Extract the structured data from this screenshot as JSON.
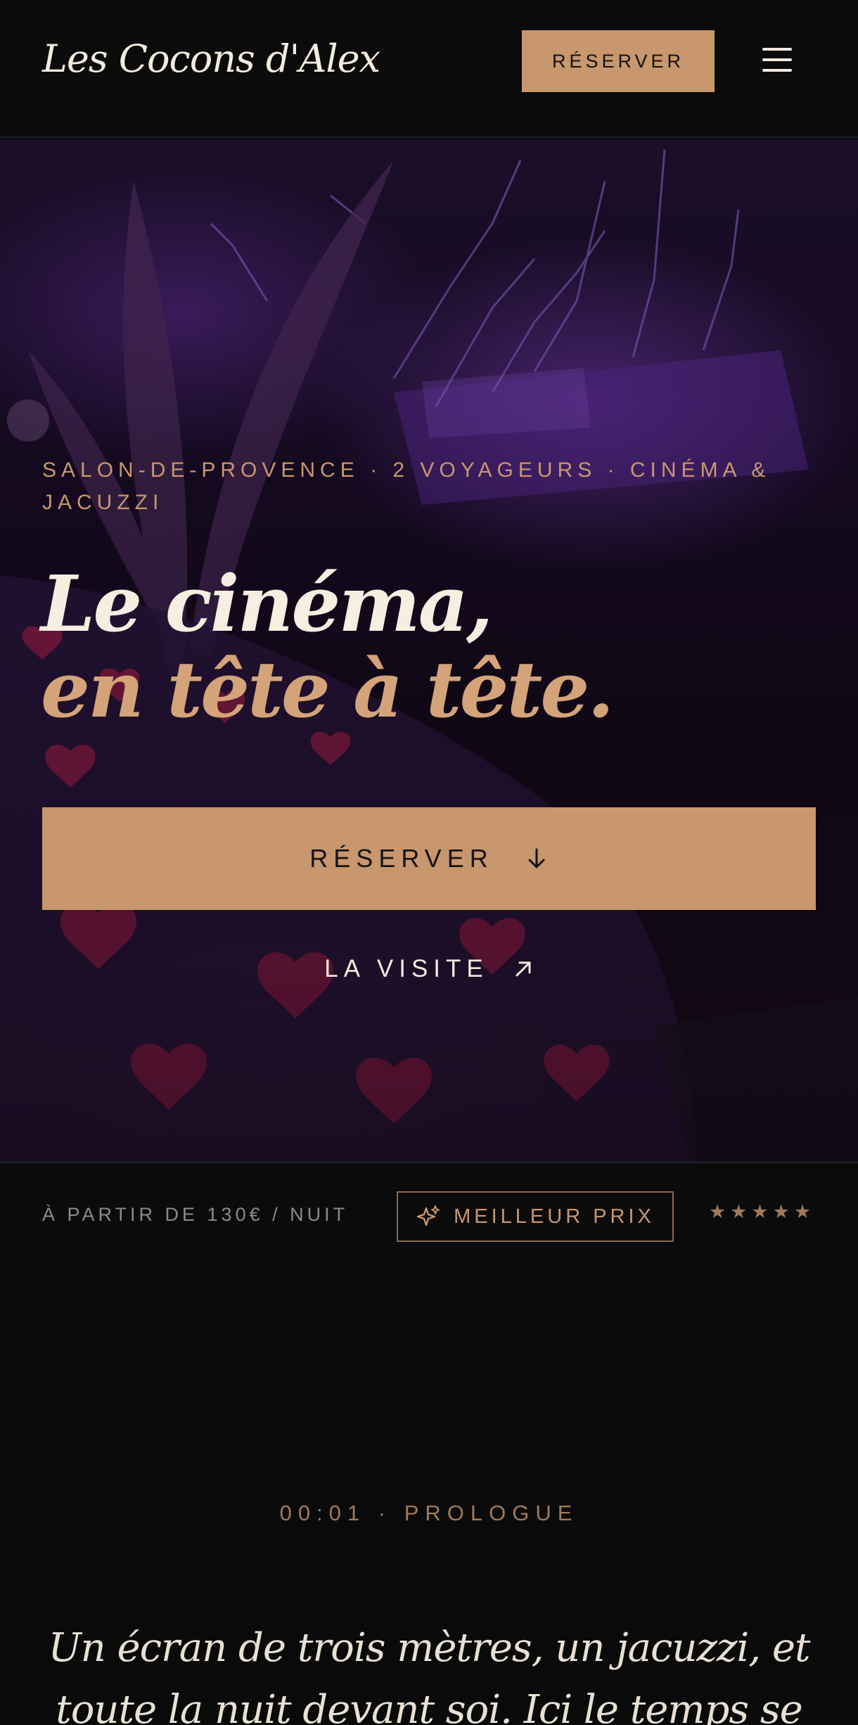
{
  "header": {
    "brand": "Les Cocons d'Alex",
    "reserve_label": "RÉSERVER",
    "menu_icon": "hamburger-menu-icon"
  },
  "hero": {
    "eyebrow": "SALON-DE-PROVENCE · 2 VOYAGEURS · CINÉMA & JACUZZI",
    "title_line1": "Le cinéma,",
    "title_line2": "en tête à tête.",
    "reserve_label": "RÉSERVER",
    "reserve_icon": "arrow-down-icon",
    "visit_label": "LA VISITE",
    "visit_icon": "arrow-up-right-icon"
  },
  "info": {
    "price": "À PARTIR DE 130€ / NUIT",
    "badge_label": "MEILLEUR PRIX",
    "badge_icon": "sparkles-icon",
    "stars": "★★★★★"
  },
  "prologue": {
    "label": "00:01 · PROLOGUE",
    "text": "Un écran de trois mètres, un jacuzzi, et toute la nuit devant soi. Ici le temps se dilate, entre"
  },
  "colors": {
    "accent": "#c8976d",
    "background": "#0a0a0b",
    "text": "#f2e9dc"
  }
}
